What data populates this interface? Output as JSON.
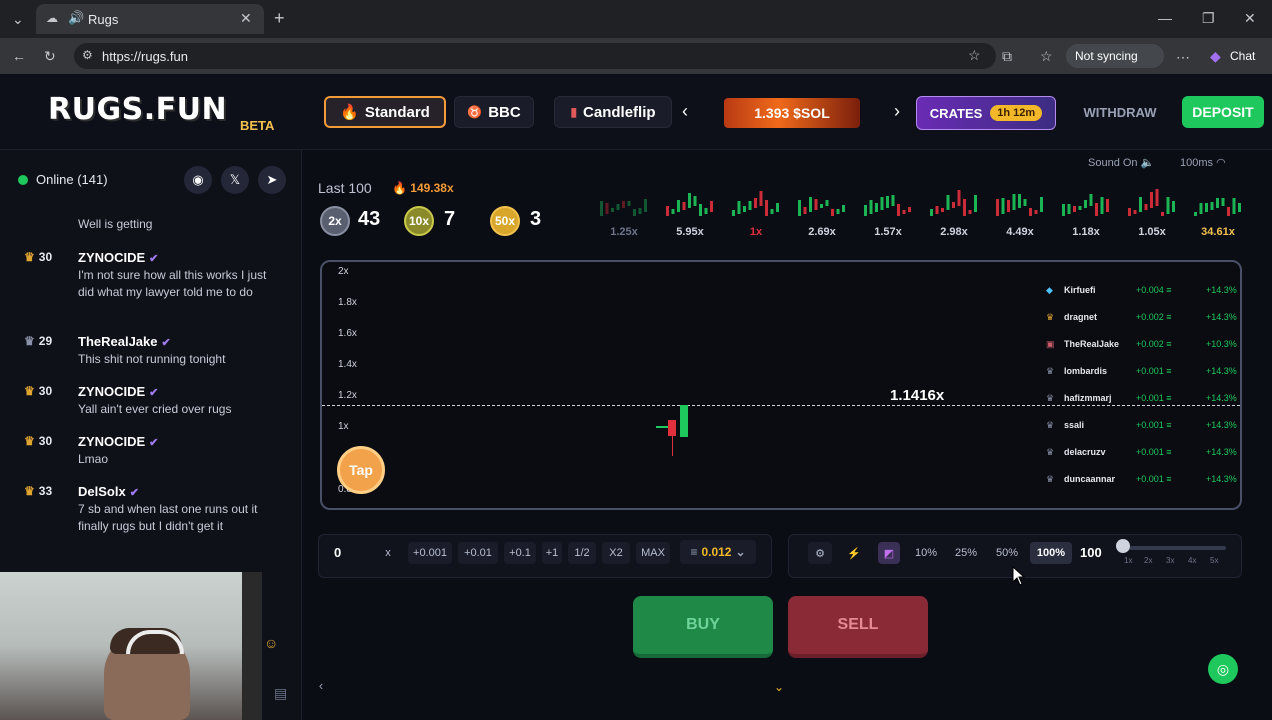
{
  "browser": {
    "tab_title": "Rugs",
    "url": "https://rugs.fun",
    "sync_label": "Not syncing",
    "chat_label": "Chat"
  },
  "header": {
    "logo": "RUGS.FUN",
    "logo_sub": "BETA",
    "nav": [
      {
        "label": "Standard"
      },
      {
        "label": "BBC"
      },
      {
        "label": "Candleflip"
      }
    ],
    "sol_banner": "1.393 $SOL",
    "crates_label": "CRATES",
    "crates_timer": "1h 12m",
    "withdraw_label": "WITHDRAW",
    "deposit_label": "DEPOSIT"
  },
  "sidebar": {
    "online_label": "Online (141)",
    "messages": [
      {
        "level": "",
        "user": "",
        "text": "Well is getting",
        "crown": "gold"
      },
      {
        "level": "30",
        "user": "ZYNOCIDE",
        "text": "I'm not sure how all this works I just did what my lawyer told me to do",
        "crown": "gold"
      },
      {
        "level": "29",
        "user": "TheRealJake",
        "text": "This shit not running tonight",
        "crown": "gray"
      },
      {
        "level": "30",
        "user": "ZYNOCIDE",
        "text": "Yall ain't ever cried over rugs",
        "crown": "gold"
      },
      {
        "level": "30",
        "user": "ZYNOCIDE",
        "text": "Lmao",
        "crown": "gold"
      },
      {
        "level": "33",
        "user": "DelSolx",
        "text": "7 sb and when last one runs out it finally rugs but I didn't get it",
        "crown": "gold"
      }
    ]
  },
  "main": {
    "last100_label": "Last 100",
    "last100_badge": "149.38x",
    "stats": [
      {
        "label": "2x",
        "count": "43"
      },
      {
        "label": "10x",
        "count": "7"
      },
      {
        "label": "50x",
        "count": "3"
      }
    ],
    "history": [
      "1.25x",
      "5.95x",
      "1x",
      "2.69x",
      "1.57x",
      "2.98x",
      "4.49x",
      "1.18x",
      "1.05x",
      "34.61x"
    ],
    "sound_label": "Sound On",
    "latency_label": "100ms",
    "chart": {
      "y_ticks": [
        "2x",
        "1.8x",
        "1.6x",
        "1.4x",
        "1.2x",
        "1x",
        "0.8x"
      ],
      "current_multiplier": "1.1416x",
      "tap_label": "Tap"
    },
    "players": [
      {
        "name": "Kirfuefi",
        "amount": "+0.004",
        "pct": "+14.3%"
      },
      {
        "name": "dragnet",
        "amount": "+0.002",
        "pct": "+14.3%"
      },
      {
        "name": "TheRealJake",
        "amount": "+0.002",
        "pct": "+10.3%"
      },
      {
        "name": "lombardis",
        "amount": "+0.001",
        "pct": "+14.3%"
      },
      {
        "name": "hafizmmarj",
        "amount": "+0.001",
        "pct": "+14.3%"
      },
      {
        "name": "ssali",
        "amount": "+0.001",
        "pct": "+14.3%"
      },
      {
        "name": "delacruzv",
        "amount": "+0.001",
        "pct": "+14.3%"
      },
      {
        "name": "duncaannar",
        "amount": "+0.001",
        "pct": "+14.3%"
      }
    ],
    "trade": {
      "amount": "0",
      "clear": "x",
      "increments": [
        "+0.001",
        "+0.01",
        "+0.1",
        "+1",
        "1/2",
        "X2",
        "MAX"
      ],
      "sol_amount": "0.012",
      "percents": [
        "10%",
        "25%",
        "50%",
        "100%"
      ],
      "active_percent": "100%",
      "slider_value": "100",
      "leverage_ticks": [
        "1x",
        "2x",
        "3x",
        "4x",
        "5x"
      ],
      "buy_label": "BUY",
      "sell_label": "SELL"
    }
  }
}
